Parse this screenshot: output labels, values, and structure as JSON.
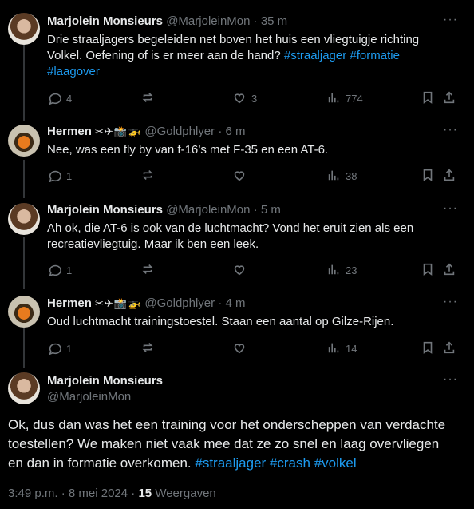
{
  "replies": [
    {
      "name": "Marjolein Monsieurs",
      "emoji": "",
      "handle": "@MarjoleinMon",
      "dot": "·",
      "time": "35 m",
      "text_parts": [
        {
          "t": "Drie straaljagers begeleiden net boven het huis een vliegtuigje richting Volkel. Oefening of is er meer aan de hand? "
        },
        {
          "t": "#straaljager",
          "tag": true
        },
        {
          "t": " "
        },
        {
          "t": "#formatie",
          "tag": true
        },
        {
          "t": " "
        },
        {
          "t": "#laagover",
          "tag": true
        }
      ],
      "replies": "4",
      "reposts": "",
      "likes": "3",
      "views": "774"
    },
    {
      "name": "Hermen",
      "emoji": "✂✈📸🚁",
      "handle": "@Goldphlyer",
      "dot": "·",
      "time": "6 m",
      "text_parts": [
        {
          "t": "Nee, was een fly by van f-16’s met F-35 en een AT-6."
        }
      ],
      "replies": "1",
      "reposts": "",
      "likes": "",
      "views": "38"
    },
    {
      "name": "Marjolein Monsieurs",
      "emoji": "",
      "handle": "@MarjoleinMon",
      "dot": "·",
      "time": "5 m",
      "text_parts": [
        {
          "t": "Ah ok, die AT-6 is ook van de luchtmacht? Vond het eruit zien als een recreatievliegtuig. Maar ik ben een leek."
        }
      ],
      "replies": "1",
      "reposts": "",
      "likes": "",
      "views": "23"
    },
    {
      "name": "Hermen",
      "emoji": "✂✈📸🚁",
      "handle": "@Goldphlyer",
      "dot": "·",
      "time": "4 m",
      "text_parts": [
        {
          "t": "Oud luchtmacht trainingstoestel. Staan een aantal op Gilze-Rijen."
        }
      ],
      "replies": "1",
      "reposts": "",
      "likes": "",
      "views": "14"
    }
  ],
  "main": {
    "name": "Marjolein Monsieurs",
    "handle": "@MarjoleinMon",
    "text_parts": [
      {
        "t": "Ok, dus dan was het een training voor het onderscheppen van verdachte toestellen? We maken niet vaak mee dat ze zo snel en laag overvliegen en dan in formatie overkomen. "
      },
      {
        "t": "#straaljager",
        "tag": true
      },
      {
        "t": " "
      },
      {
        "t": "#crash",
        "tag": true
      },
      {
        "t": " "
      },
      {
        "t": "#volkel",
        "tag": true
      }
    ],
    "time": "3:49 p.m.",
    "date": "8 mei 2024",
    "views_count": "15",
    "views_label": "Weergaven"
  },
  "more_icon": "more-dots-icon",
  "colors": {
    "background": "#000000",
    "text": "#e7e9ea",
    "muted": "#71767b",
    "link": "#1d9bf0"
  }
}
